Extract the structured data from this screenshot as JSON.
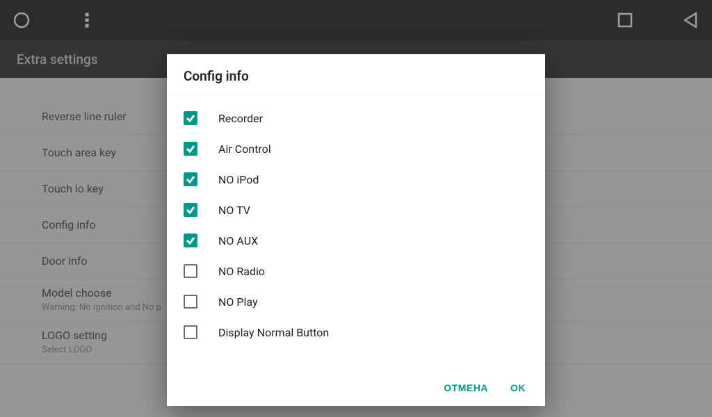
{
  "titlebar": {
    "title": "Extra settings"
  },
  "settings": {
    "rows": [
      {
        "title": "Reverse line ruler",
        "sub": ""
      },
      {
        "title": "Touch area key",
        "sub": ""
      },
      {
        "title": "Touch io key",
        "sub": ""
      },
      {
        "title": "Config info",
        "sub": ""
      },
      {
        "title": "Door info",
        "sub": ""
      },
      {
        "title": "Model choose",
        "sub": "Warning: No ignition and No p"
      },
      {
        "title": "LOGO setting",
        "sub": "Select LOGO"
      }
    ]
  },
  "dialog": {
    "title": "Config info",
    "options": [
      {
        "label": "Recorder",
        "checked": true
      },
      {
        "label": "Air Control",
        "checked": true
      },
      {
        "label": "NO iPod",
        "checked": true
      },
      {
        "label": "NO TV",
        "checked": true
      },
      {
        "label": "NO AUX",
        "checked": true
      },
      {
        "label": "NO Radio",
        "checked": false
      },
      {
        "label": "NO Play",
        "checked": false
      },
      {
        "label": "Display Normal Button",
        "checked": false
      }
    ],
    "cancel_label": "ОТМЕНА",
    "ok_label": "OK"
  },
  "colors": {
    "accent": "#009688"
  }
}
